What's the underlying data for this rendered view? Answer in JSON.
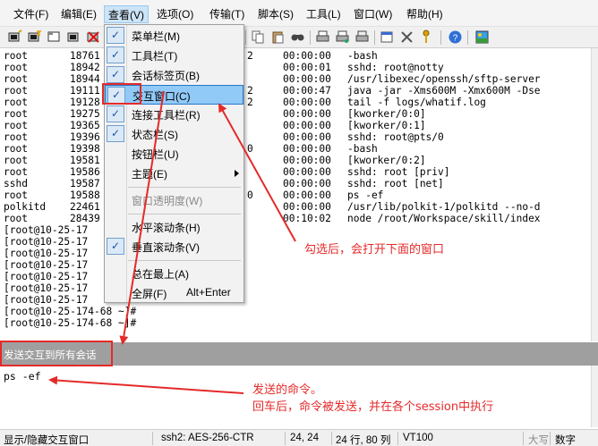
{
  "menubar": {
    "items": [
      "文件(F)",
      "编辑(E)",
      "查看(V)",
      "选项(O)",
      "传输(T)",
      "脚本(S)",
      "工具(L)",
      "窗口(W)",
      "帮助(H)"
    ]
  },
  "toolbar": {
    "buttons": [
      "connect-icon",
      "quick-connect-icon",
      "connect-tab-icon",
      "reconnect-icon",
      "disconnect-icon",
      "copy-icon",
      "paste-icon",
      "find-icon",
      "print-icon",
      "print-setup-icon",
      "properties-icon",
      "keymap-icon",
      "sftp-icon",
      "help-icon",
      "image-icon"
    ]
  },
  "terminal": {
    "process_rows": [
      {
        "user": "root",
        "pid": "18761",
        "extra": "2",
        "time": "00:00:00",
        "cmd": "-bash"
      },
      {
        "user": "root",
        "pid": "18942",
        "extra": "",
        "time": "00:00:01",
        "cmd": "sshd: root@notty"
      },
      {
        "user": "root",
        "pid": "18944",
        "extra": "",
        "time": "00:00:00",
        "cmd": "/usr/libexec/openssh/sftp-server"
      },
      {
        "user": "root",
        "pid": "19111",
        "extra": "2",
        "time": "00:00:47",
        "cmd": "java -jar -Xms600M -Xmx600M -Dse"
      },
      {
        "user": "root",
        "pid": "19128",
        "extra": "2",
        "time": "00:00:00",
        "cmd": "tail -f logs/whatif.log"
      },
      {
        "user": "root",
        "pid": "19275",
        "extra": "",
        "time": "00:00:00",
        "cmd": "[kworker/0:0]"
      },
      {
        "user": "root",
        "pid": "19365",
        "extra": "",
        "time": "00:00:00",
        "cmd": "[kworker/0:1]"
      },
      {
        "user": "root",
        "pid": "19396",
        "extra": "",
        "time": "00:00:00",
        "cmd": "sshd: root@pts/0"
      },
      {
        "user": "root",
        "pid": "19398",
        "extra": "0",
        "time": "00:00:00",
        "cmd": "-bash"
      },
      {
        "user": "root",
        "pid": "19581",
        "extra": "",
        "time": "00:00:00",
        "cmd": "[kworker/0:2]"
      },
      {
        "user": "root",
        "pid": "19586",
        "extra": "",
        "time": "00:00:00",
        "cmd": "sshd: root [priv]"
      },
      {
        "user": "sshd",
        "pid": "19587",
        "extra": "",
        "time": "00:00:00",
        "cmd": "sshd: root [net]"
      },
      {
        "user": "root",
        "pid": "19588",
        "extra": "0",
        "time": "00:00:00",
        "cmd": "ps -ef"
      },
      {
        "user": "polkitd",
        "pid": "22461",
        "extra": "",
        "time": "00:00:00",
        "cmd": "/usr/lib/polkit-1/polkitd --no-d"
      },
      {
        "user": "root",
        "pid": "28439",
        "extra": "",
        "time": "00:10:02",
        "cmd": "node /root/Workspace/skill/index"
      }
    ],
    "prompt_lines": [
      "[root@10-25-17",
      "[root@10-25-17",
      "[root@10-25-17",
      "[root@10-25-17",
      "[root@10-25-17",
      "[root@10-25-17",
      "[root@10-25-17",
      "[root@10-25-174-68 ~]#",
      "[root@10-25-174-68 ~]#"
    ]
  },
  "dropdown": {
    "items": [
      {
        "label": "菜单栏(M)",
        "checked": true
      },
      {
        "label": "工具栏(T)",
        "checked": true
      },
      {
        "label": "会话标签页(B)",
        "checked": true
      },
      {
        "label": "交互窗口(C)",
        "checked": true
      },
      {
        "label": "连接工具栏(R)",
        "checked": true
      },
      {
        "label": "状态栏(S)",
        "checked": true
      },
      {
        "label": "按钮栏(U)",
        "checked": false
      },
      {
        "label": "主题(E)",
        "checked": false
      },
      {
        "label": "窗口透明度(W)",
        "checked": false
      },
      {
        "label": "水平滚动条(H)",
        "checked": false
      },
      {
        "label": "垂直滚动条(V)",
        "checked": true
      },
      {
        "label": "总在最上(A)",
        "checked": false
      },
      {
        "label": "全屏(F)",
        "checked": false,
        "shortcut": "Alt+Enter"
      }
    ]
  },
  "sendbar": {
    "label": "发送交互到所有会话"
  },
  "send_input": {
    "value": "ps -ef"
  },
  "statusbar": {
    "hint": "显示/隐藏交互窗口",
    "cipher": "ssh2: AES-256-CTR",
    "cursor": "24,  24",
    "size": "24 行, 80 列",
    "term": "VT100",
    "caps": "大写",
    "num": "数字"
  },
  "annotations": {
    "note1": "勾选后，会打开下面的窗口",
    "note2_line1": "发送的命令。",
    "note2_line2": "回车后，命令被发送，并在各个session中执行"
  },
  "colors": {
    "annotation_red": "#e52a2a",
    "menu_highlight": "#91c9f7",
    "sendbar_gray": "#9f9f9f"
  }
}
